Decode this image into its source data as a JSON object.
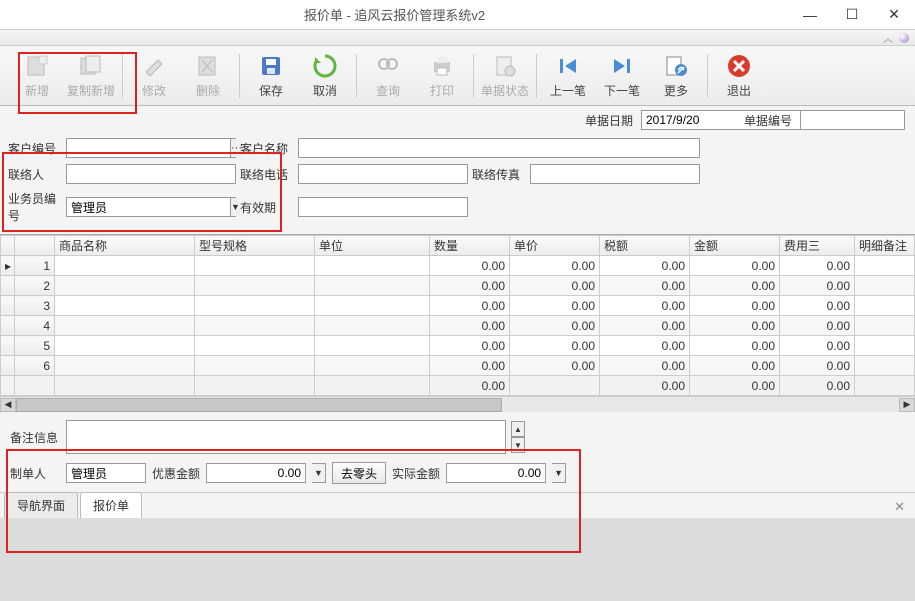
{
  "window": {
    "title": "报价单 - 追风云报价管理系统v2"
  },
  "toolbar": {
    "new": "新增",
    "copy_new": "复制新增",
    "modify": "修改",
    "delete": "删除",
    "save": "保存",
    "cancel": "取消",
    "query": "查询",
    "print": "打印",
    "status": "单据状态",
    "prev": "上一笔",
    "next": "下一笔",
    "more": "更多",
    "exit": "退出"
  },
  "datebar": {
    "date_label": "单据日期",
    "date_value": "2017/9/20",
    "docno_label": "单据编号",
    "docno_value": ""
  },
  "form": {
    "labels": {
      "cust_no": "客户编号",
      "cust_name": "客户名称",
      "contact": "联络人",
      "phone": "联络电话",
      "fax": "联络传真",
      "sales": "业务员编号",
      "valid": "有效期"
    },
    "values": {
      "cust_no": "",
      "cust_name": "",
      "contact": "",
      "phone": "",
      "fax": "",
      "sales": "管理员",
      "valid": ""
    }
  },
  "columns": [
    "",
    "",
    "商品名称",
    "型号规格",
    "单位",
    "数量",
    "单价",
    "税额",
    "金额",
    "费用三",
    "明细备注"
  ],
  "rows": [
    {
      "n": "1",
      "qty": "0.00",
      "price": "0.00",
      "tax": "0.00",
      "amt": "0.00",
      "fee": "0.00"
    },
    {
      "n": "2",
      "qty": "0.00",
      "price": "0.00",
      "tax": "0.00",
      "amt": "0.00",
      "fee": "0.00"
    },
    {
      "n": "3",
      "qty": "0.00",
      "price": "0.00",
      "tax": "0.00",
      "amt": "0.00",
      "fee": "0.00"
    },
    {
      "n": "4",
      "qty": "0.00",
      "price": "0.00",
      "tax": "0.00",
      "amt": "0.00",
      "fee": "0.00"
    },
    {
      "n": "5",
      "qty": "0.00",
      "price": "0.00",
      "tax": "0.00",
      "amt": "0.00",
      "fee": "0.00"
    },
    {
      "n": "6",
      "qty": "0.00",
      "price": "0.00",
      "tax": "0.00",
      "amt": "0.00",
      "fee": "0.00"
    }
  ],
  "totals": {
    "qty": "0.00",
    "tax": "0.00",
    "amt": "0.00",
    "fee": "0.00"
  },
  "footer": {
    "remark_label": "备注信息",
    "remark": "",
    "maker_label": "制单人",
    "maker": "管理员",
    "discount_label": "优惠金额",
    "discount": "0.00",
    "round_btn": "去零头",
    "actual_label": "实际金额",
    "actual": "0.00"
  },
  "tabs": {
    "nav": "导航界面",
    "quote": "报价单"
  }
}
